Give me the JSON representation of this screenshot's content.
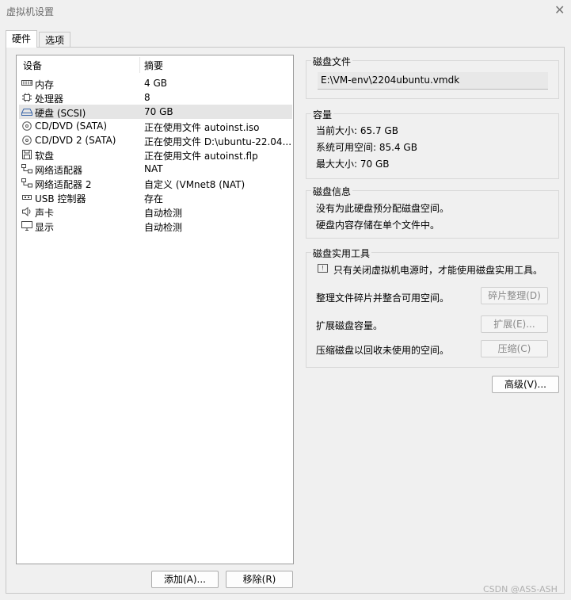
{
  "window": {
    "title": "虚拟机设置"
  },
  "tabs": [
    {
      "label": "硬件",
      "active": true
    },
    {
      "label": "选项",
      "active": false
    }
  ],
  "devices": {
    "columns": {
      "device": "设备",
      "summary": "摘要"
    },
    "rows": [
      {
        "name": "内存",
        "summary": "4 GB",
        "icon": "memory-icon"
      },
      {
        "name": "处理器",
        "summary": "8",
        "icon": "cpu-icon"
      },
      {
        "name": "硬盘 (SCSI)",
        "summary": "70 GB",
        "icon": "hard-disk-icon",
        "selected": true
      },
      {
        "name": "CD/DVD (SATA)",
        "summary": "正在使用文件 autoinst.iso",
        "icon": "cd-dvd-icon"
      },
      {
        "name": "CD/DVD 2 (SATA)",
        "summary": "正在使用文件 D:\\ubuntu-22.04...",
        "icon": "cd-dvd-icon"
      },
      {
        "name": "软盘",
        "summary": "正在使用文件 autoinst.flp",
        "icon": "floppy-icon"
      },
      {
        "name": "网络适配器",
        "summary": "NAT",
        "icon": "network-icon"
      },
      {
        "name": "网络适配器 2",
        "summary": "自定义 (VMnet8 (NAT)",
        "icon": "network-icon"
      },
      {
        "name": "USB 控制器",
        "summary": "存在",
        "icon": "usb-icon"
      },
      {
        "name": "声卡",
        "summary": "自动检测",
        "icon": "speaker-icon"
      },
      {
        "name": "显示",
        "summary": "自动检测",
        "icon": "monitor-icon"
      }
    ],
    "add_button": "添加(A)...",
    "remove_button": "移除(R)"
  },
  "disk_file": {
    "title": "磁盘文件",
    "path": "E:\\VM-env\\2204ubuntu.vmdk"
  },
  "capacity": {
    "title": "容量",
    "current": "当前大小: 65.7 GB",
    "available": "系统可用空间: 85.4 GB",
    "max": "最大大小: 70 GB"
  },
  "disk_info": {
    "title": "磁盘信息",
    "line1": "没有为此硬盘预分配磁盘空间。",
    "line2": "硬盘内容存储在单个文件中。"
  },
  "utilities": {
    "title": "磁盘实用工具",
    "notice": "只有关闭虚拟机电源时，才能使用磁盘实用工具。",
    "defrag_label": "整理文件碎片并整合可用空间。",
    "defrag_button": "碎片整理(D)",
    "expand_label": "扩展磁盘容量。",
    "expand_button": "扩展(E)...",
    "compact_label": "压缩磁盘以回收未使用的空间。",
    "compact_button": "压缩(C)"
  },
  "advanced_button": "高级(V)...",
  "watermark": "CSDN @ASS-ASH"
}
